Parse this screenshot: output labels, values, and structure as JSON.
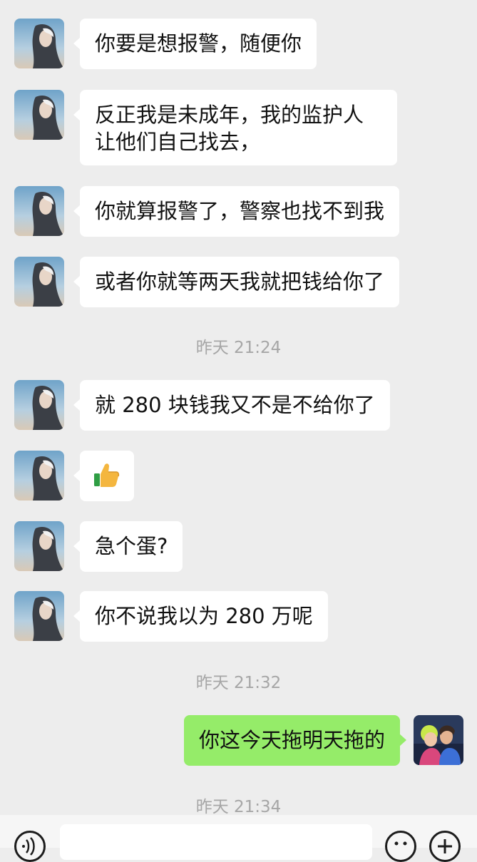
{
  "messages": [
    {
      "side": "left",
      "text": "你要是想报警，随便你"
    },
    {
      "side": "left",
      "text": "反正我是未成年，我的监护人让他们自己找去，"
    },
    {
      "side": "left",
      "text": "你就算报警了，警察也找不到我"
    },
    {
      "side": "left",
      "text": "或者你就等两天我就把钱给你了"
    },
    {
      "side": "time",
      "text": "昨天 21:24"
    },
    {
      "side": "left",
      "text": "就 280 块钱我又不是不给你了"
    },
    {
      "side": "left",
      "emoji": "👍",
      "icon": "thumbs-up-emoji"
    },
    {
      "side": "left",
      "text": "急个蛋?"
    },
    {
      "side": "left",
      "text": "你不说我以为 280 万呢"
    },
    {
      "side": "time",
      "text": "昨天 21:32"
    },
    {
      "side": "right",
      "text": "你这今天拖明天拖的"
    },
    {
      "side": "time",
      "text": "昨天 21:34"
    }
  ],
  "colors": {
    "background": "#ededed",
    "bubble_in": "#ffffff",
    "bubble_out": "#95ec69",
    "timestamp": "#a6a6a6"
  },
  "input_bar": {
    "voice_icon": "voice-icon",
    "emoji_icon": "emoji-icon",
    "plus_icon": "plus-icon"
  }
}
